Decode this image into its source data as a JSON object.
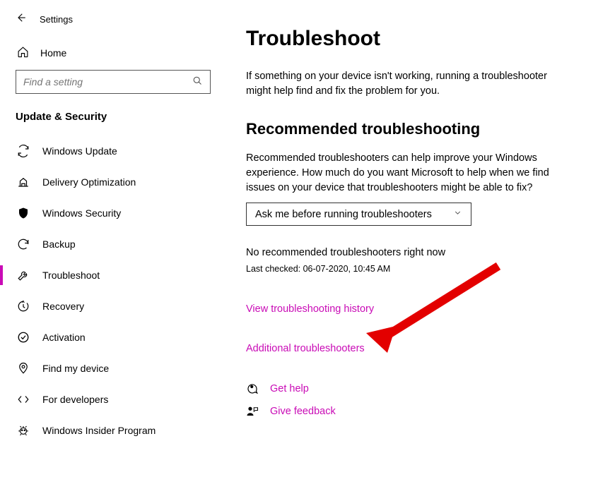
{
  "titlebar": {
    "title": "Settings"
  },
  "home_label": "Home",
  "search": {
    "placeholder": "Find a setting"
  },
  "section_header": "Update & Security",
  "nav": [
    {
      "id": "windows-update",
      "label": "Windows Update"
    },
    {
      "id": "delivery-optimization",
      "label": "Delivery Optimization"
    },
    {
      "id": "windows-security",
      "label": "Windows Security"
    },
    {
      "id": "backup",
      "label": "Backup"
    },
    {
      "id": "troubleshoot",
      "label": "Troubleshoot",
      "selected": true
    },
    {
      "id": "recovery",
      "label": "Recovery"
    },
    {
      "id": "activation",
      "label": "Activation"
    },
    {
      "id": "find-my-device",
      "label": "Find my device"
    },
    {
      "id": "for-developers",
      "label": "For developers"
    },
    {
      "id": "windows-insider",
      "label": "Windows Insider Program"
    }
  ],
  "page": {
    "title": "Troubleshoot",
    "intro": "If something on your device isn't working, running a troubleshooter might help find and fix the problem for you.",
    "recommended_heading": "Recommended troubleshooting",
    "recommended_text": "Recommended troubleshooters can help improve your Windows experience. How much do you want Microsoft to help when we find issues on your device that troubleshooters might be able to fix?",
    "dropdown_value": "Ask me before running troubleshooters",
    "status": "No recommended troubleshooters right now",
    "last_checked": "Last checked: 06-07-2020, 10:45 AM",
    "view_history_link": "View troubleshooting history",
    "additional_link": "Additional troubleshooters",
    "get_help": "Get help",
    "give_feedback": "Give feedback"
  }
}
